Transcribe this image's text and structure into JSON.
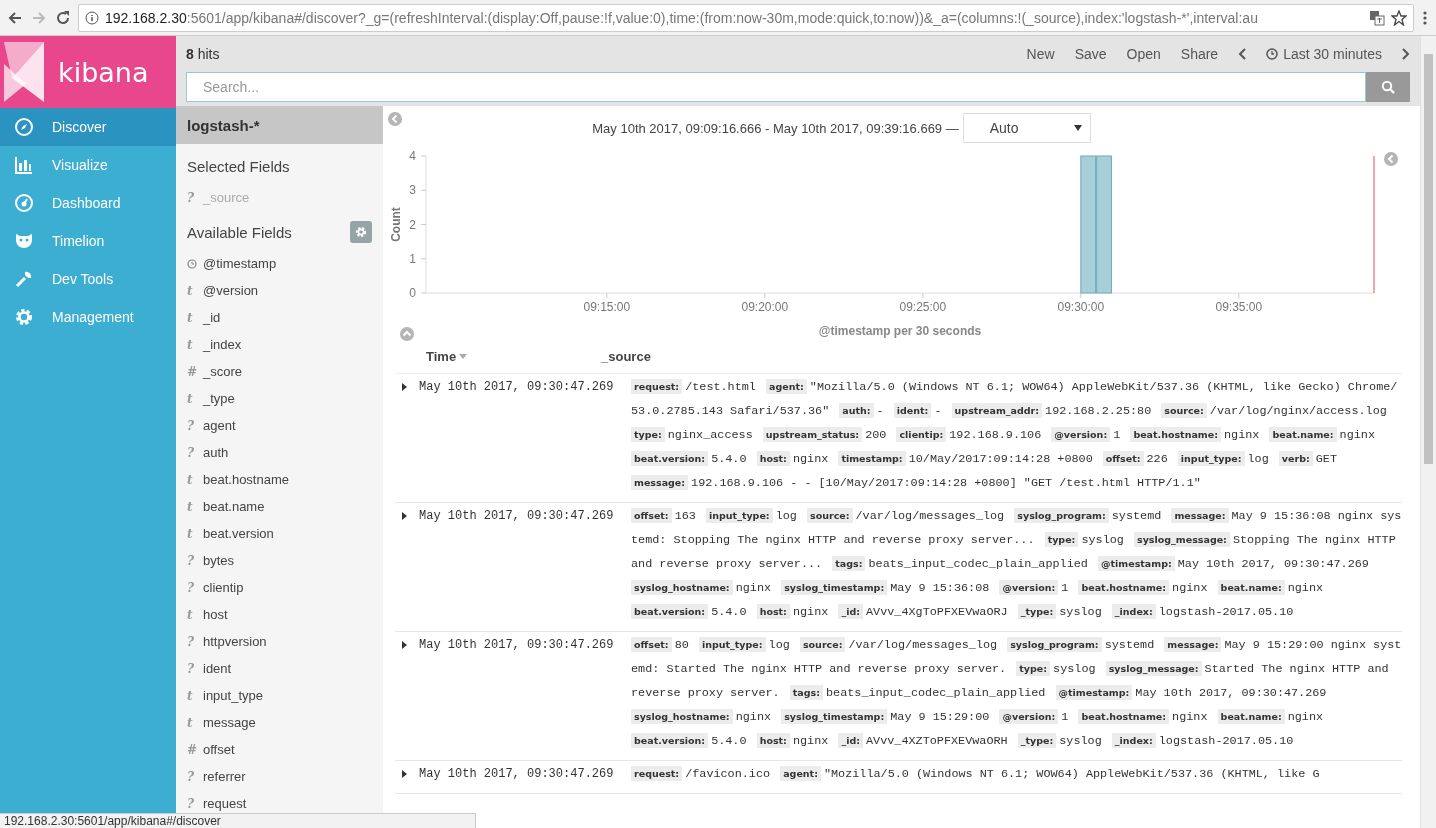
{
  "browser": {
    "url_host": "192.168.2.30",
    "url_path": ":5601/app/kibana#/discover?_g=(refreshInterval:(display:Off,pause:!f,value:0),time:(from:now-30m,mode:quick,to:now))&_a=(columns:!(_source),index:'logstash-*',interval:au"
  },
  "sidebar": {
    "logo": "kibana",
    "items": [
      {
        "label": "Discover",
        "selected": true
      },
      {
        "label": "Visualize",
        "selected": false
      },
      {
        "label": "Dashboard",
        "selected": false
      },
      {
        "label": "Timelion",
        "selected": false
      },
      {
        "label": "Dev Tools",
        "selected": false
      },
      {
        "label": "Management",
        "selected": false
      }
    ]
  },
  "topbar": {
    "hits": "**8** hits",
    "links": [
      "New",
      "Save",
      "Open",
      "Share"
    ],
    "time_range": "Last 30 minutes"
  },
  "search": {
    "placeholder": "Search..."
  },
  "fields": {
    "index_pattern": "logstash-*",
    "selected_heading": "Selected Fields",
    "selected": [
      {
        "kind": "unknown",
        "symbol": "?",
        "name": "_source"
      }
    ],
    "available_heading": "Available Fields",
    "available": [
      {
        "kind": "date",
        "name": "@timestamp"
      },
      {
        "kind": "string",
        "symbol": "t",
        "name": "@version"
      },
      {
        "kind": "string",
        "symbol": "t",
        "name": "_id"
      },
      {
        "kind": "string",
        "symbol": "t",
        "name": "_index"
      },
      {
        "kind": "number",
        "symbol": "#",
        "name": "_score"
      },
      {
        "kind": "string",
        "symbol": "t",
        "name": "_type"
      },
      {
        "kind": "unknown",
        "symbol": "?",
        "name": "agent"
      },
      {
        "kind": "unknown",
        "symbol": "?",
        "name": "auth"
      },
      {
        "kind": "string",
        "symbol": "t",
        "name": "beat.hostname"
      },
      {
        "kind": "string",
        "symbol": "t",
        "name": "beat.name"
      },
      {
        "kind": "string",
        "symbol": "t",
        "name": "beat.version"
      },
      {
        "kind": "unknown",
        "symbol": "?",
        "name": "bytes"
      },
      {
        "kind": "unknown",
        "symbol": "?",
        "name": "clientip"
      },
      {
        "kind": "string",
        "symbol": "t",
        "name": "host"
      },
      {
        "kind": "unknown",
        "symbol": "?",
        "name": "httpversion"
      },
      {
        "kind": "unknown",
        "symbol": "?",
        "name": "ident"
      },
      {
        "kind": "string",
        "symbol": "t",
        "name": "input_type"
      },
      {
        "kind": "string",
        "symbol": "t",
        "name": "message"
      },
      {
        "kind": "number",
        "symbol": "#",
        "name": "offset"
      },
      {
        "kind": "unknown",
        "symbol": "?",
        "name": "referrer"
      },
      {
        "kind": "unknown",
        "symbol": "?",
        "name": "request"
      }
    ]
  },
  "histogram": {
    "range": "May 10th 2017, 09:09:16.666 - May 10th 2017, 09:39:16.669 —",
    "interval": "Auto",
    "chart_data": {
      "type": "bar",
      "xlabel": "@timestamp per 30 seconds",
      "ylabel": "Count",
      "categories": [
        null,
        null,
        null,
        null,
        null,
        null,
        null,
        null,
        null,
        null,
        null,
        "09:15:00",
        null,
        null,
        null,
        null,
        null,
        null,
        null,
        null,
        null,
        "09:20:00",
        null,
        null,
        null,
        null,
        null,
        null,
        null,
        null,
        null,
        "09:25:00",
        null,
        null,
        null,
        null,
        null,
        null,
        null,
        null,
        null,
        "09:30:00",
        null,
        null,
        null,
        null,
        null,
        null,
        null,
        null,
        null,
        "09:35:00",
        null,
        null,
        null,
        null,
        null,
        null,
        null,
        null
      ],
      "values": [
        0,
        0,
        0,
        0,
        0,
        0,
        0,
        0,
        0,
        0,
        0,
        0,
        0,
        0,
        0,
        0,
        0,
        0,
        0,
        0,
        0,
        0,
        0,
        0,
        0,
        0,
        0,
        0,
        0,
        0,
        0,
        0,
        0,
        0,
        0,
        0,
        0,
        0,
        0,
        0,
        0,
        4,
        4,
        0,
        0,
        0,
        0,
        0,
        0,
        0,
        0,
        0,
        0,
        0,
        0,
        0,
        0,
        0,
        0,
        0
      ],
      "ylim": [
        0,
        4
      ],
      "yticks": [
        0,
        1,
        2,
        3,
        4
      ]
    }
  },
  "table": {
    "columns": [
      "Time",
      "_source"
    ],
    "rows": [
      {
        "time": "May 10th 2017, 09:30:47.269",
        "source": [
          [
            "request:",
            "/test.html"
          ],
          [
            "agent:",
            "\"Mozilla/5.0 (Windows NT 6.1; WOW64) AppleWebKit/537.36 (KHTML, like Gecko) Chrome/53.0.2785.143 Safari/537.36\""
          ],
          [
            "auth:",
            "-"
          ],
          [
            "ident:",
            "-"
          ],
          [
            "upstream_addr:",
            "192.168.2.25:80"
          ],
          [
            "source:",
            "/var/log/nginx/access.log"
          ],
          [
            "type:",
            "nginx_access"
          ],
          [
            "upstream_status:",
            "200"
          ],
          [
            "clientip:",
            "192.168.9.106"
          ],
          [
            "@version:",
            "1"
          ],
          [
            "beat.hostname:",
            "nginx"
          ],
          [
            "beat.name:",
            "nginx"
          ],
          [
            "beat.version:",
            "5.4.0"
          ],
          [
            "host:",
            "nginx"
          ],
          [
            "timestamp:",
            "10/May/2017:09:14:28 +0800"
          ],
          [
            "offset:",
            "226"
          ],
          [
            "input_type:",
            "log"
          ],
          [
            "verb:",
            "GET"
          ],
          [
            "message:",
            "192.168.9.106 - - [10/May/2017:09:14:28 +0800] \"GET /test.html HTTP/1.1\""
          ]
        ]
      },
      {
        "time": "May 10th 2017, 09:30:47.269",
        "source": [
          [
            "offset:",
            "163"
          ],
          [
            "input_type:",
            "log"
          ],
          [
            "source:",
            "/var/log/messages_log"
          ],
          [
            "syslog_program:",
            "systemd"
          ],
          [
            "message:",
            "May 9 15:36:08 nginx systemd: Stopping The nginx HTTP and reverse proxy server..."
          ],
          [
            "type:",
            "syslog"
          ],
          [
            "syslog_message:",
            "Stopping The nginx HTTP and reverse proxy server..."
          ],
          [
            "tags:",
            "beats_input_codec_plain_applied"
          ],
          [
            "@timestamp:",
            "May 10th 2017, 09:30:47.269"
          ],
          [
            "syslog_hostname:",
            "nginx"
          ],
          [
            "syslog_timestamp:",
            "May 9 15:36:08"
          ],
          [
            "@version:",
            "1"
          ],
          [
            "beat.hostname:",
            "nginx"
          ],
          [
            "beat.name:",
            "nginx"
          ],
          [
            "beat.version:",
            "5.4.0"
          ],
          [
            "host:",
            "nginx"
          ],
          [
            "_id:",
            "AVvv_4XgToPFXEVwaORJ"
          ],
          [
            "_type:",
            "syslog"
          ],
          [
            "_index:",
            "logstash-2017.05.10"
          ]
        ]
      },
      {
        "time": "May 10th 2017, 09:30:47.269",
        "source": [
          [
            "offset:",
            "80"
          ],
          [
            "input_type:",
            "log"
          ],
          [
            "source:",
            "/var/log/messages_log"
          ],
          [
            "syslog_program:",
            "systemd"
          ],
          [
            "message:",
            "May 9 15:29:00 nginx systemd: Started The nginx HTTP and reverse proxy server."
          ],
          [
            "type:",
            "syslog"
          ],
          [
            "syslog_message:",
            "Started The nginx HTTP and reverse proxy server."
          ],
          [
            "tags:",
            "beats_input_codec_plain_applied"
          ],
          [
            "@timestamp:",
            "May 10th 2017, 09:30:47.269"
          ],
          [
            "syslog_hostname:",
            "nginx"
          ],
          [
            "syslog_timestamp:",
            "May 9 15:29:00"
          ],
          [
            "@version:",
            "1"
          ],
          [
            "beat.hostname:",
            "nginx"
          ],
          [
            "beat.name:",
            "nginx"
          ],
          [
            "beat.version:",
            "5.4.0"
          ],
          [
            "host:",
            "nginx"
          ],
          [
            "_id:",
            "AVvv_4XZToPFXEVwaORH"
          ],
          [
            "_type:",
            "syslog"
          ],
          [
            "_index:",
            "logstash-2017.05.10"
          ]
        ]
      },
      {
        "time": "May 10th 2017, 09:30:47.269",
        "source": [
          [
            "request:",
            "/favicon.ico"
          ],
          [
            "agent:",
            "\"Mozilla/5.0 (Windows NT 6.1; WOW64) AppleWebKit/537.36 (KHTML, like G"
          ]
        ]
      }
    ]
  },
  "status_bar": "192.168.2.30:5601/app/kibana#/discover"
}
